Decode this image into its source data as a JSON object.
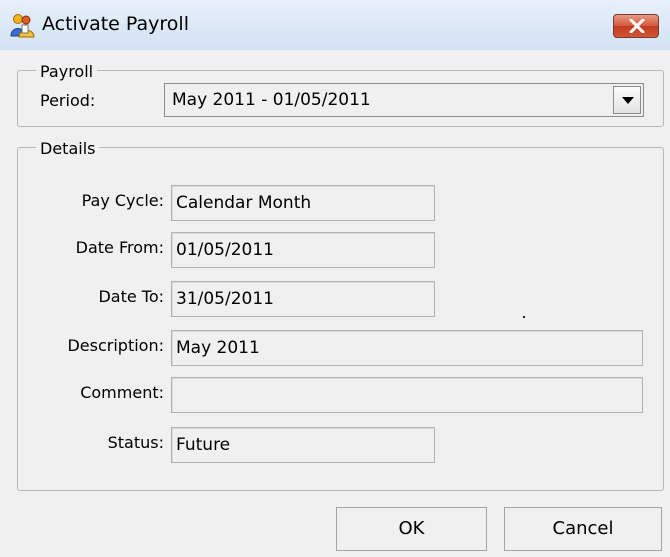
{
  "window": {
    "title": "Activate Payroll"
  },
  "payroll_group": {
    "legend": "Payroll",
    "period_label": "Period:",
    "period_value": "May 2011 - 01/05/2011"
  },
  "details_group": {
    "legend": "Details",
    "fields": [
      {
        "label": "Pay Cycle:",
        "value": "Calendar Month"
      },
      {
        "label": "Date From:",
        "value": "01/05/2011"
      },
      {
        "label": "Date To:",
        "value": "31/05/2011"
      },
      {
        "label": "Description:",
        "value": "May 2011"
      },
      {
        "label": "Comment:",
        "value": ""
      },
      {
        "label": "Status:",
        "value": "Future"
      }
    ]
  },
  "buttons": {
    "ok": "OK",
    "cancel": "Cancel"
  },
  "colors": {
    "close_button": "#c94a2d",
    "titlebar": "#dbe8f6",
    "background": "#f0f0f0"
  },
  "icons": {
    "app": "payroll-people-icon",
    "close": "close-icon",
    "dropdown": "chevron-down-icon"
  }
}
